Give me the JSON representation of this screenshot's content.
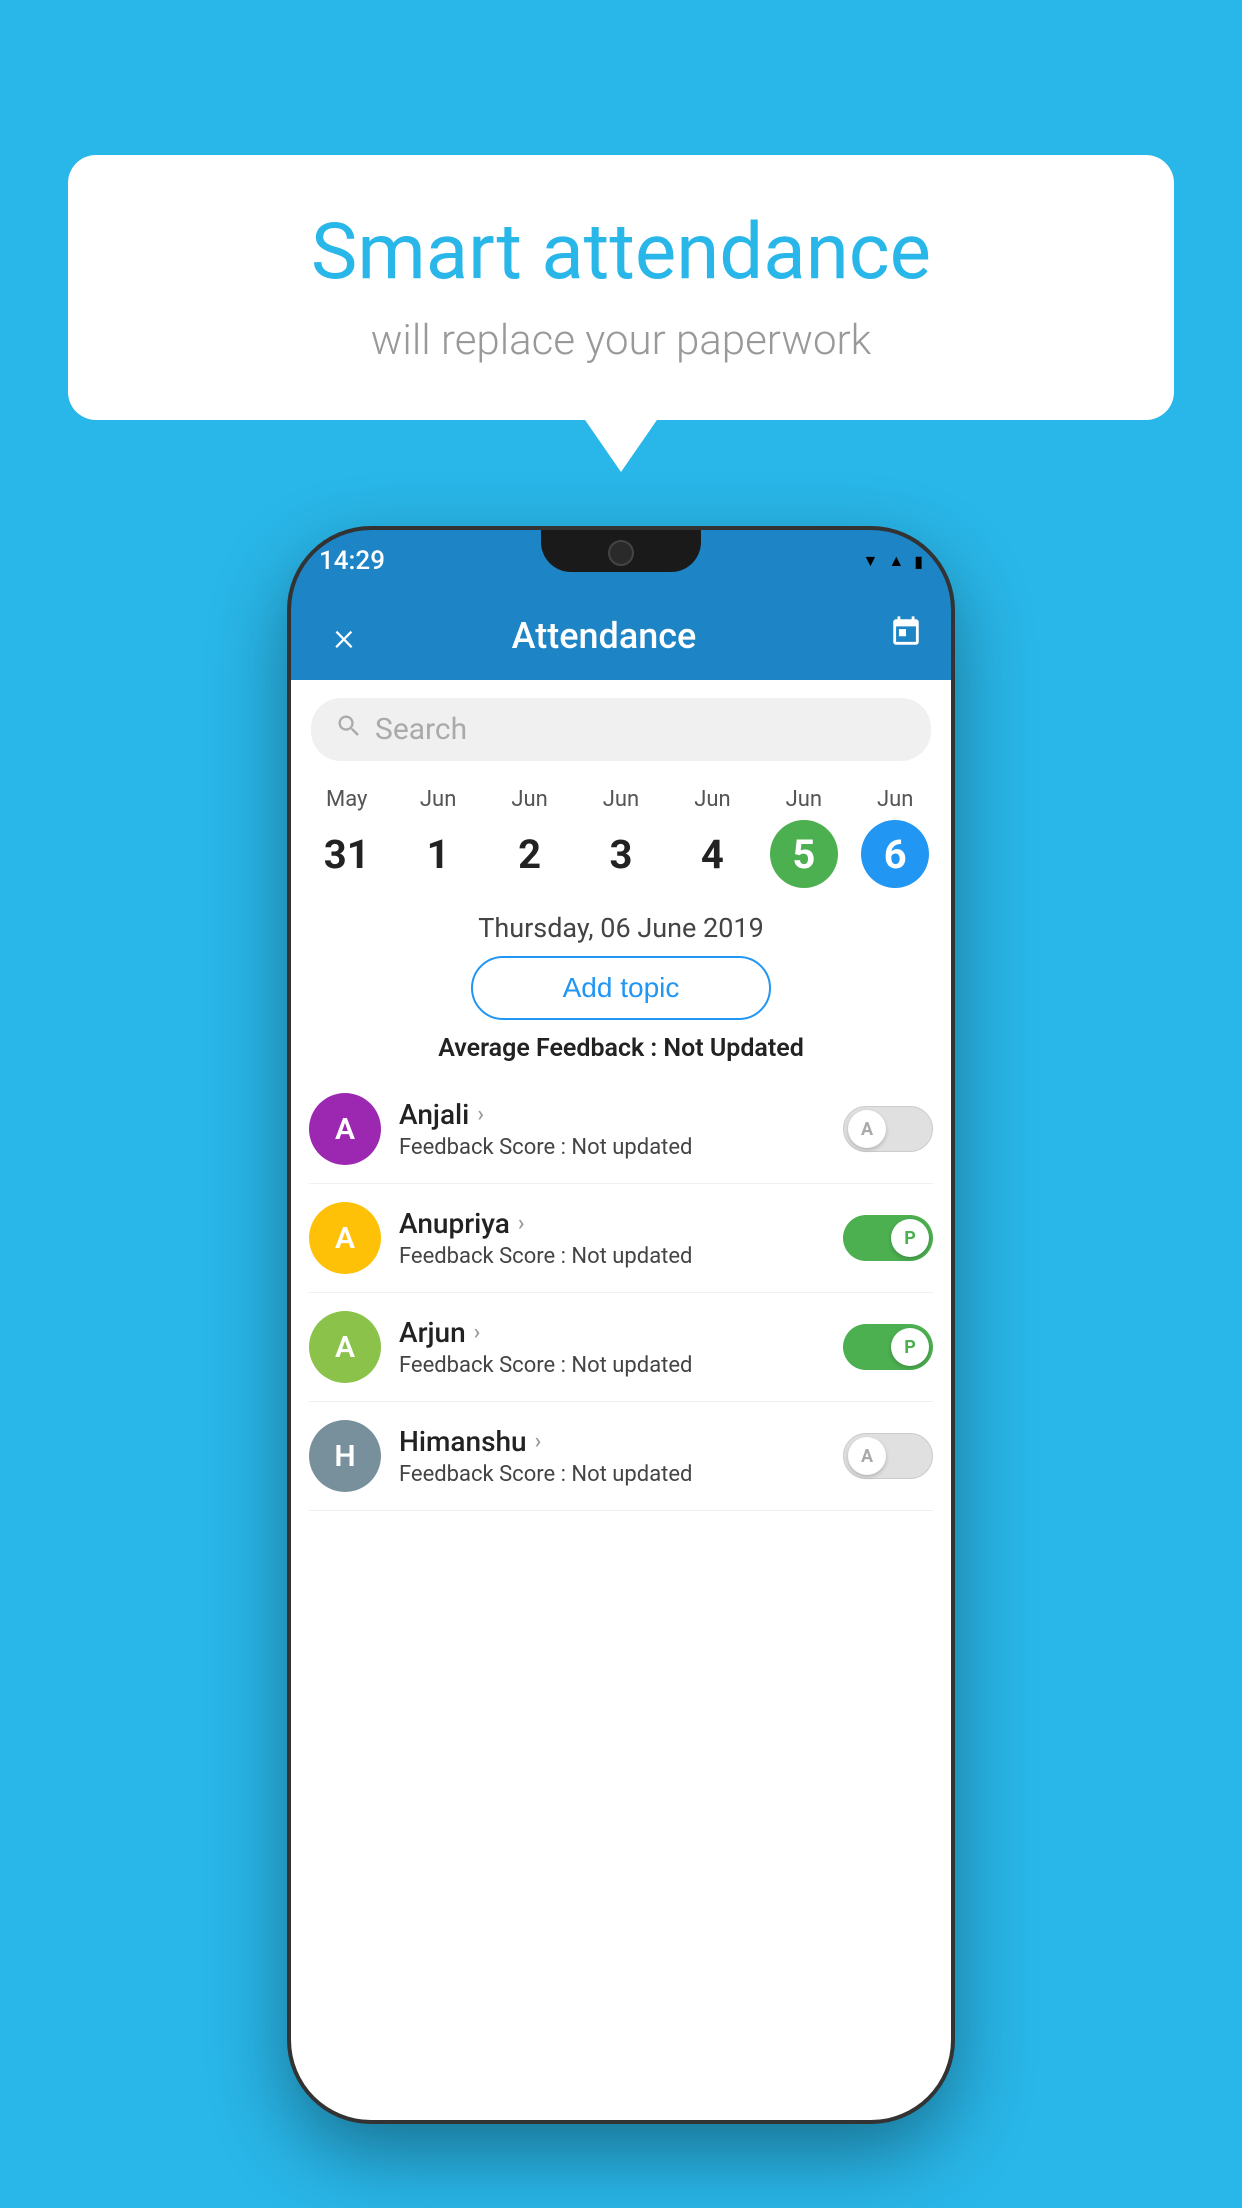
{
  "background_color": "#29b6e8",
  "bubble": {
    "title": "Smart attendance",
    "subtitle": "will replace your paperwork"
  },
  "status_bar": {
    "time": "14:29",
    "icons": [
      "wifi",
      "signal",
      "battery"
    ]
  },
  "app_bar": {
    "title": "Attendance",
    "close_label": "×",
    "calendar_icon": "📅"
  },
  "search": {
    "placeholder": "Search"
  },
  "calendar": {
    "dates": [
      {
        "month": "May",
        "day": "31",
        "state": "normal"
      },
      {
        "month": "Jun",
        "day": "1",
        "state": "normal"
      },
      {
        "month": "Jun",
        "day": "2",
        "state": "normal"
      },
      {
        "month": "Jun",
        "day": "3",
        "state": "normal"
      },
      {
        "month": "Jun",
        "day": "4",
        "state": "normal"
      },
      {
        "month": "Jun",
        "day": "5",
        "state": "today"
      },
      {
        "month": "Jun",
        "day": "6",
        "state": "selected"
      }
    ],
    "selected_date_label": "Thursday, 06 June 2019"
  },
  "add_topic_label": "Add topic",
  "avg_feedback_label": "Average Feedback : ",
  "avg_feedback_value": "Not Updated",
  "students": [
    {
      "name": "Anjali",
      "avatar_letter": "A",
      "avatar_color": "#9c27b0",
      "score_label": "Feedback Score : ",
      "score_value": "Not updated",
      "toggle_state": "off",
      "toggle_label": "A"
    },
    {
      "name": "Anupriya",
      "avatar_letter": "A",
      "avatar_color": "#ffc107",
      "score_label": "Feedback Score : ",
      "score_value": "Not updated",
      "toggle_state": "on",
      "toggle_label": "P"
    },
    {
      "name": "Arjun",
      "avatar_letter": "A",
      "avatar_color": "#8bc34a",
      "score_label": "Feedback Score : ",
      "score_value": "Not updated",
      "toggle_state": "on",
      "toggle_label": "P"
    },
    {
      "name": "Himanshu",
      "avatar_letter": "H",
      "avatar_color": "#78909c",
      "score_label": "Feedback Score : ",
      "score_value": "Not updated",
      "toggle_state": "off",
      "toggle_label": "A"
    }
  ]
}
